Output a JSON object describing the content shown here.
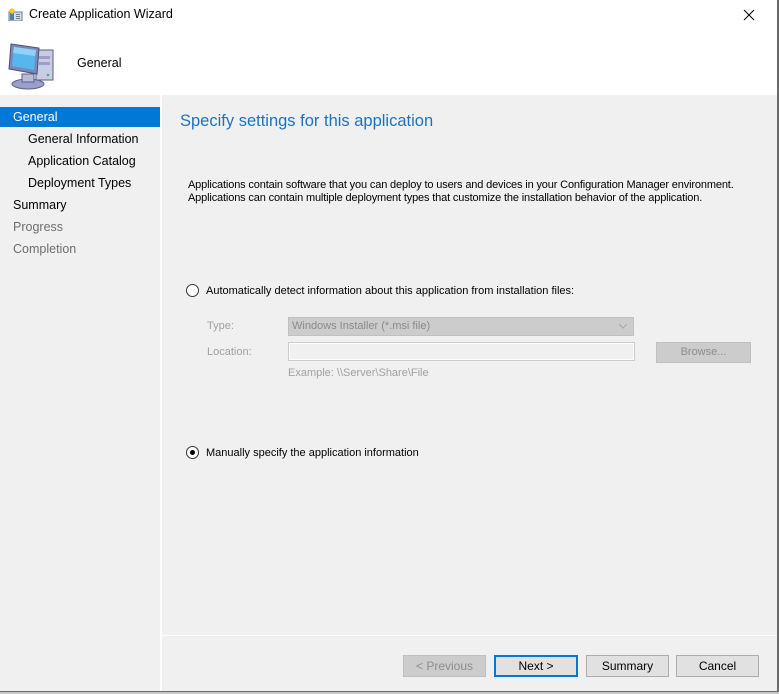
{
  "window": {
    "title": "Create Application Wizard",
    "title_icon": "wizard-icon",
    "close_icon": "close-icon"
  },
  "header": {
    "title": "General",
    "icon": "computer-icon"
  },
  "nav": {
    "items": [
      {
        "label": "General",
        "state": "active",
        "level": 0
      },
      {
        "label": "General Information",
        "state": "normal",
        "level": 1
      },
      {
        "label": "Application Catalog",
        "state": "normal",
        "level": 1
      },
      {
        "label": "Deployment Types",
        "state": "normal",
        "level": 1
      },
      {
        "label": "Summary",
        "state": "normal",
        "level": 0
      },
      {
        "label": "Progress",
        "state": "disabled",
        "level": 0
      },
      {
        "label": "Completion",
        "state": "disabled",
        "level": 0
      }
    ]
  },
  "content": {
    "title": "Specify settings for this application",
    "description_line1": "Applications contain software that you can deploy to users and devices in your Configuration Manager environment.",
    "description_line2": "Applications can contain multiple deployment types that customize the installation behavior of the application.",
    "auto_detect": {
      "label": "Automatically detect information about this application from installation files:",
      "checked": false,
      "type_label": "Type:",
      "type_value": "Windows Installer (*.msi file)",
      "location_label": "Location:",
      "location_value": "",
      "browse_label": "Browse...",
      "example": "Example: \\\\Server\\Share\\File"
    },
    "manual": {
      "label": "Manually specify the application information",
      "checked": true
    }
  },
  "footer": {
    "previous_label": "< Previous",
    "next_label": "Next >",
    "summary_label": "Summary",
    "cancel_label": "Cancel"
  },
  "colors": {
    "accent": "#0078d7",
    "title_blue": "#1e73be",
    "panel_bg": "#f0f0f0"
  }
}
